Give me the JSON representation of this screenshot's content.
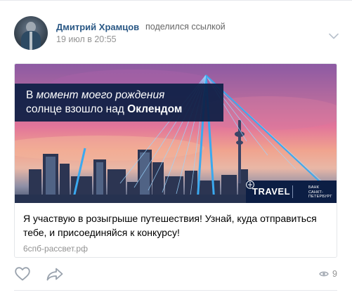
{
  "post": {
    "author": "Дмитрий Храмцов",
    "action": "поделился ссылкой",
    "date": "19 июл в 20:55"
  },
  "link": {
    "banner_line1_prefix": "В ",
    "banner_line1_italic": "момент моего рождения",
    "banner_line2_prefix": "солнце взошло над ",
    "banner_line2_bold": "Оклендом",
    "badge_label": "TRAVEL",
    "bank_line1": "БАНК",
    "bank_line2": "САНКТ-",
    "bank_line3": "ПЕТЕРБУРГ",
    "title": "Я участвую в розыгрыше путешествия! Узнай, куда отправиться тебе, и присоединяйся к конкурсу!",
    "domain": "6спб-рассвет.рф"
  },
  "actions": {
    "views": "9"
  },
  "colors": {
    "author_link": "#2a5885",
    "muted": "#939393",
    "banner_bg": "#0c1e44",
    "icon_gray": "#99a2ad"
  },
  "icons": [
    "avatar",
    "chevron-down-icon",
    "heart-icon",
    "share-arrow-icon",
    "eye-icon",
    "bank-logo-icon"
  ]
}
